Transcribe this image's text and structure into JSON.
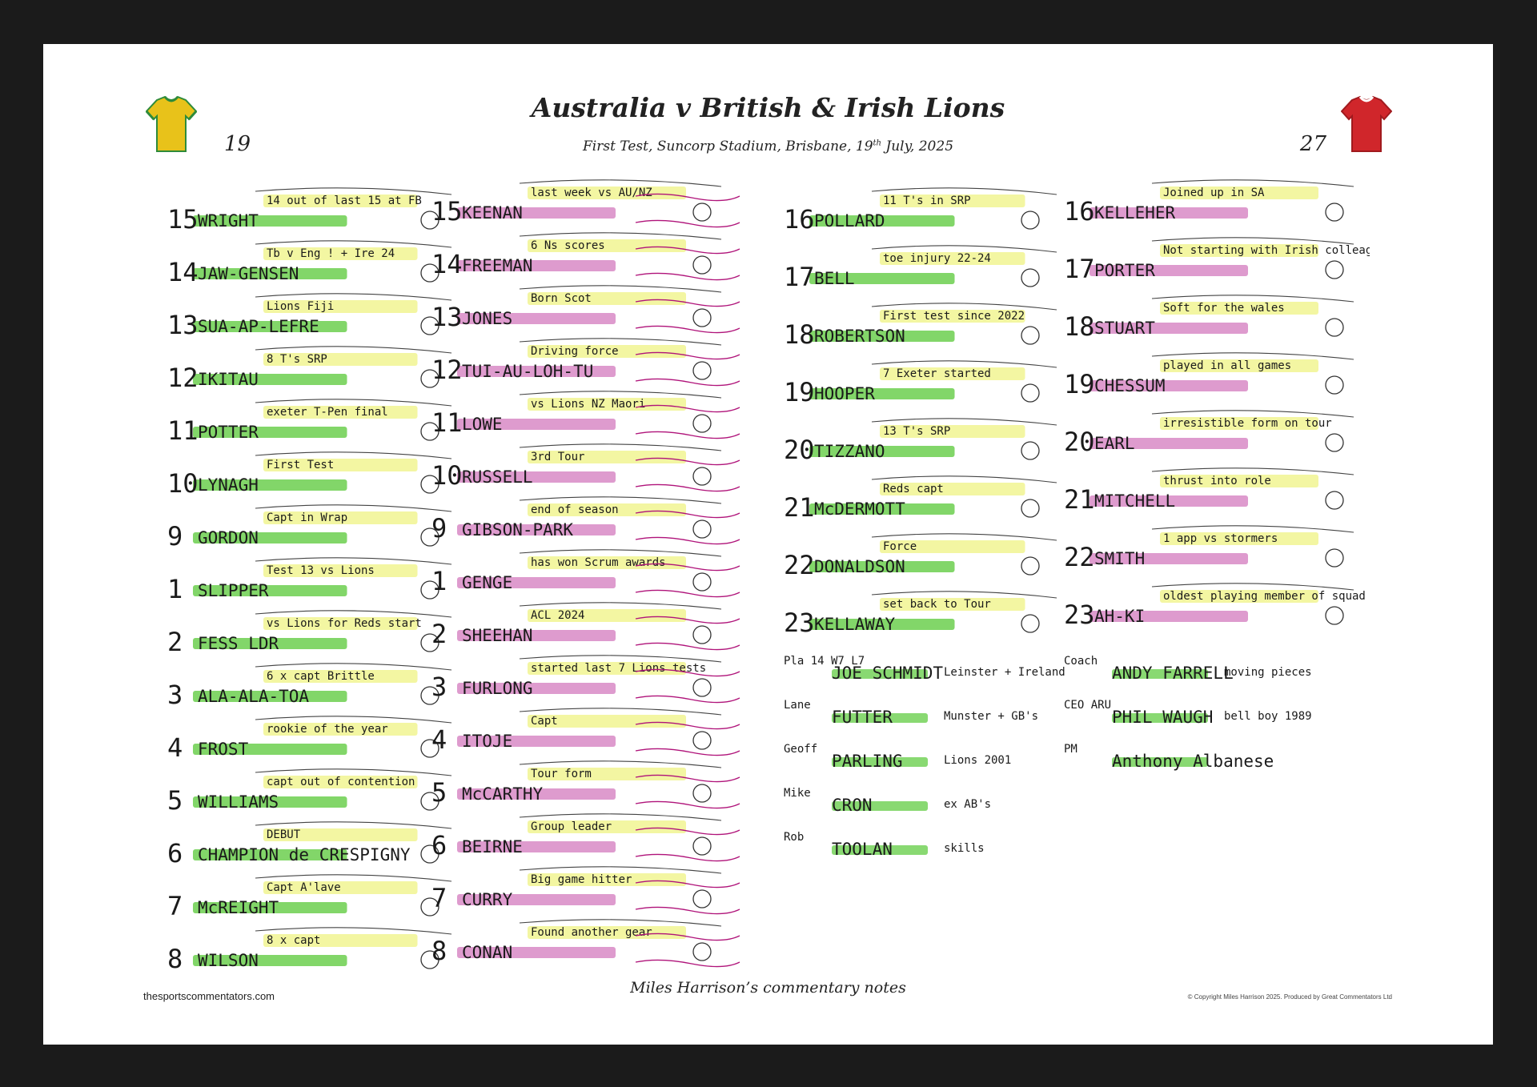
{
  "poster": {
    "title": "Australia v British & Irish Lions",
    "subtitle_main": "First Test, Suncorp Stadium, Brisbane, 19",
    "subtitle_sup": "th",
    "subtitle_end": " July, 2025",
    "left_count": "19",
    "right_count": "27",
    "caption": "Miles Harrison’s commentary notes",
    "site": "thesportscommentators.com",
    "copyright": "© Copyright Miles Harrison 2025. Produced by Great Commentators Ltd"
  },
  "colors": {
    "australia_shirt": "#e8c21a",
    "australia_trim": "#2e8b3a",
    "lions_shirt": "#d0262b",
    "lions_trim": "#ffffff",
    "highlight_green": "#6ccf4f",
    "highlight_yellow": "#eef27a",
    "highlight_pink": "#d889c6",
    "note_magenta": "#b0147a"
  },
  "icons": {
    "left": "green-gold-jersey-icon",
    "right": "red-jersey-icon"
  },
  "australia": [
    {
      "num": "15",
      "name": "WRIGHT",
      "note": "14 out of last 15 at FB"
    },
    {
      "num": "14",
      "name": "JAW-GENSEN",
      "note": "Tb v Eng ! + Ire 24"
    },
    {
      "num": "13",
      "name": "SUA-AP-LEFRE",
      "note": "Lions Fiji"
    },
    {
      "num": "12",
      "name": "IKITAU",
      "note": "8 T's SRP"
    },
    {
      "num": "11",
      "name": "POTTER",
      "note": "exeter T-Pen final"
    },
    {
      "num": "10",
      "name": "LYNAGH",
      "note": "First Test"
    },
    {
      "num": "9",
      "name": "GORDON",
      "note": "Capt in Wrap"
    },
    {
      "num": "1",
      "name": "SLIPPER",
      "note": "Test 13 vs Lions"
    },
    {
      "num": "2",
      "name": "FESS LDR",
      "note": "vs Lions for Reds start"
    },
    {
      "num": "3",
      "name": "ALA-ALA-TOA",
      "note": "6 x capt Brittle"
    },
    {
      "num": "4",
      "name": "FROST",
      "note": "rookie of the year"
    },
    {
      "num": "5",
      "name": "WILLIAMS",
      "note": "capt out of contention"
    },
    {
      "num": "6",
      "name": "CHAMPION de CRESPIGNY",
      "note": "DEBUT"
    },
    {
      "num": "7",
      "name": "McREIGHT",
      "note": "Capt A'lave"
    },
    {
      "num": "8",
      "name": "WILSON",
      "note": "8 x capt"
    }
  ],
  "lions_backs": [
    {
      "num": "15",
      "name": "KEENAN",
      "note": "last week vs AU/NZ"
    },
    {
      "num": "14",
      "name": "FREEMAN",
      "note": "6 Ns scores"
    },
    {
      "num": "13",
      "name": "JONES",
      "note": "Born Scot"
    },
    {
      "num": "12",
      "name": "TUI-AU-LOH-TU",
      "note": "Driving force"
    },
    {
      "num": "11",
      "name": "LOWE",
      "note": "vs Lions NZ Maori"
    },
    {
      "num": "10",
      "name": "RUSSELL",
      "note": "3rd Tour"
    },
    {
      "num": "9",
      "name": "GIBSON-PARK",
      "note": "end of season"
    },
    {
      "num": "1",
      "name": "GENGE",
      "note": "has won Scrum awards"
    },
    {
      "num": "2",
      "name": "SHEEHAN",
      "note": "ACL 2024"
    },
    {
      "num": "3",
      "name": "FURLONG",
      "note": "started last 7 Lions tests"
    },
    {
      "num": "4",
      "name": "ITOJE",
      "note": "Capt"
    },
    {
      "num": "5",
      "name": "McCARTHY",
      "note": "Tour form"
    },
    {
      "num": "6",
      "name": "BEIRNE",
      "note": "Group leader"
    },
    {
      "num": "7",
      "name": "CURRY",
      "note": "Big game hitter"
    },
    {
      "num": "8",
      "name": "CONAN",
      "note": "Found another gear"
    }
  ],
  "aus_bench": [
    {
      "num": "16",
      "name": "POLLARD",
      "note": "11 T's in SRP"
    },
    {
      "num": "17",
      "name": "BELL",
      "note": "toe injury 22-24"
    },
    {
      "num": "18",
      "name": "ROBERTSON",
      "note": "First test since 2022"
    },
    {
      "num": "19",
      "name": "HOOPER",
      "note": "7 Exeter started"
    },
    {
      "num": "20",
      "name": "TIZZANO",
      "note": "13 T's SRP"
    },
    {
      "num": "21",
      "name": "McDERMOTT",
      "note": "Reds capt"
    },
    {
      "num": "22",
      "name": "DONALDSON",
      "note": "Force"
    },
    {
      "num": "23",
      "name": "KELLAWAY",
      "note": "set back to Tour"
    }
  ],
  "lions_bench": [
    {
      "num": "16",
      "name": "KELLEHER",
      "note": "Joined up in SA"
    },
    {
      "num": "17",
      "name": "PORTER",
      "note": "Not starting with Irish colleagues"
    },
    {
      "num": "18",
      "name": "STUART",
      "note": "Soft for the wales"
    },
    {
      "num": "19",
      "name": "CHESSUM",
      "note": "played in all games"
    },
    {
      "num": "20",
      "name": "EARL",
      "note": "irresistible form on tour"
    },
    {
      "num": "21",
      "name": "MITCHELL",
      "note": "thrust into role"
    },
    {
      "num": "22",
      "name": "SMITH",
      "note": "1 app vs stormers"
    },
    {
      "num": "23",
      "name": "AH-KI",
      "note": "oldest playing member of squad"
    }
  ],
  "staff": [
    {
      "role": "Pla 14 W7 L7",
      "name": "JOE SCHMIDT",
      "note": "Leinster + Ireland"
    },
    {
      "role": "Lane",
      "name": "FUTTER",
      "note": "Munster + GB's"
    },
    {
      "role": "Geoff",
      "name": "PARLING",
      "note": "Lions 2001"
    },
    {
      "role": "Mike",
      "name": "CRON",
      "note": "ex AB's"
    },
    {
      "role": "Rob",
      "name": "TOOLAN",
      "note": "skills"
    },
    {
      "role": "Coach",
      "name": "ANDY FARRELL",
      "note": "moving pieces"
    },
    {
      "role": "CEO ARU",
      "name": "PHIL WAUGH",
      "note": "bell boy 1989"
    },
    {
      "role": "PM",
      "name": "Anthony Albanese",
      "note": ""
    }
  ]
}
